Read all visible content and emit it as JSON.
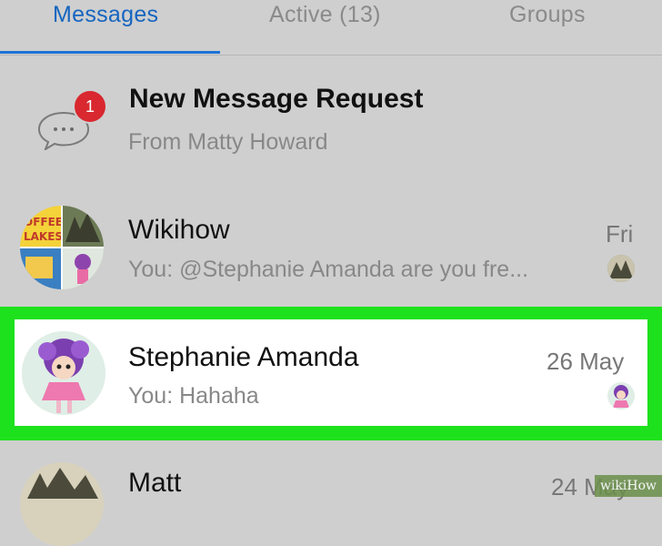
{
  "tabs": [
    {
      "label": "Messages",
      "active": true
    },
    {
      "label": "Active (13)",
      "active": false
    },
    {
      "label": "Groups",
      "active": false
    }
  ],
  "request": {
    "title": "New Message Request",
    "subtitle": "From Matty Howard",
    "badge_count": "1",
    "icon": "chat-bubble-icon"
  },
  "conversations": [
    {
      "name": "Wikihow",
      "preview": "You: @Stephanie Amanda are you fre...",
      "time": "Fri",
      "avatar": "group-collage-avatar"
    },
    {
      "name": "Stephanie Amanda",
      "preview": "You: Hahaha",
      "time": "26 May",
      "avatar": "doll-avatar",
      "highlighted": true
    },
    {
      "name": "Matt",
      "preview": "",
      "time": "24 May",
      "avatar": "sketch-avatar"
    }
  ],
  "watermark": "wikiHow",
  "colors": {
    "accent": "#1e73d6",
    "highlight": "#1ee11e",
    "badge": "#d9282f"
  }
}
